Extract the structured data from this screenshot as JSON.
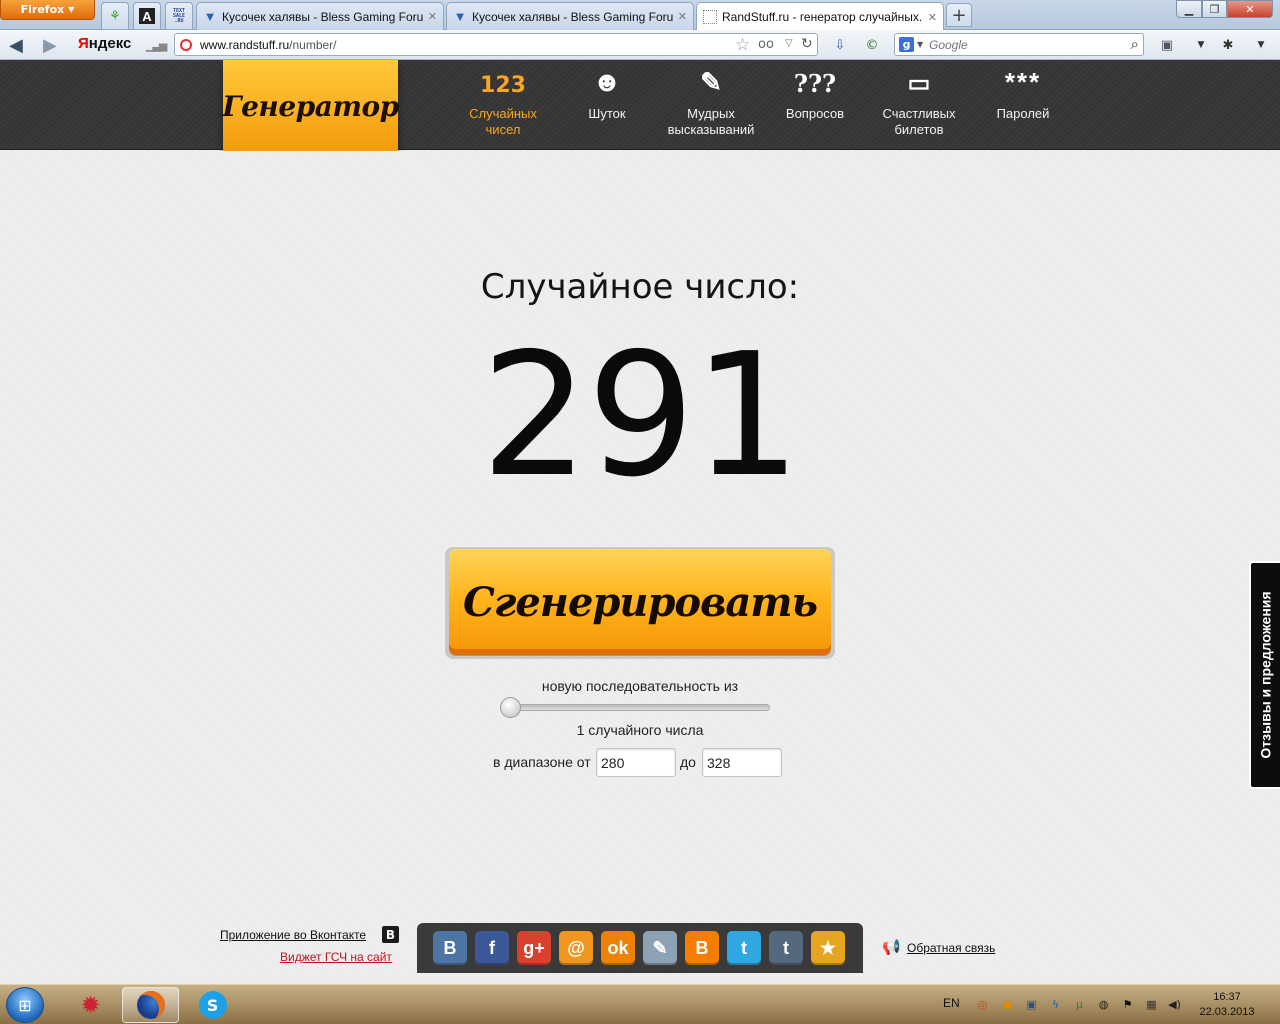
{
  "browser": {
    "menu_button_label": "Firefox",
    "app_tabs": [
      {
        "icon": "sprout-icon"
      },
      {
        "icon": "font-a-icon",
        "glyph": "A"
      },
      {
        "icon": "textsale-icon",
        "glyph": "TEXT SALE .RU"
      }
    ],
    "tabs": [
      {
        "title": "Кусочек халявы - Bless Gaming Foru...",
        "favicon": "bless-icon"
      },
      {
        "title": "Кусочек халявы - Bless Gaming Foru...",
        "favicon": "bless-icon"
      },
      {
        "title": "RandStuff.ru - генератор случайных...",
        "favicon": "blank-page-icon"
      }
    ],
    "new_tab_label": "+",
    "yandex_label": {
      "first": "Я",
      "rest": "ндекс"
    },
    "url": {
      "host": "www.randstuff.ru",
      "path": "/number/"
    },
    "search": {
      "engine_glyph": "g",
      "placeholder": "Google"
    }
  },
  "site": {
    "logo": "Генератор",
    "nav": [
      {
        "icon_text": "123",
        "label_line1": "Случайных",
        "label_line2": "чисел",
        "active": true
      },
      {
        "icon_text": "☻",
        "label_line1": "Шуток",
        "label_line2": "",
        "active": false
      },
      {
        "icon_text": "✎",
        "label_line1": "Мудрых",
        "label_line2": "высказываний",
        "active": false
      },
      {
        "icon_text": "???",
        "label_line1": "Вопросов",
        "label_line2": "",
        "active": false
      },
      {
        "icon_text": "▭",
        "label_line1": "Счастливых",
        "label_line2": "билетов",
        "active": false
      },
      {
        "icon_text": "***",
        "label_line1": "Паролей",
        "label_line2": "",
        "active": false
      }
    ],
    "result_label": "Случайное число:",
    "result_number": "291",
    "generate_button": "Сгенерировать",
    "sequence_text": "новую последовательность из",
    "slider_value_fraction": 0.0,
    "count_text": "1 случайного числа",
    "range_from_label": "в диапазоне от",
    "range_from_value": "280",
    "range_to_label": "до",
    "range_to_value": "328",
    "feedback_tab": "Отзывы и предложения",
    "vk_app_link": "Приложение во Вконтакте",
    "vk_icon_glyph": "В",
    "widget_link": "Виджет ГСЧ на сайт",
    "feedback_link": "Обратная связь",
    "share_buttons": [
      {
        "name": "vkontakte",
        "glyph": "В",
        "color": "#4c75a3"
      },
      {
        "name": "facebook",
        "glyph": "f",
        "color": "#3b5998"
      },
      {
        "name": "google-plus",
        "glyph": "g+",
        "color": "#d9412f"
      },
      {
        "name": "mail-ru",
        "glyph": "@",
        "color": "#f0961e"
      },
      {
        "name": "odnoklassniki",
        "glyph": "ok",
        "color": "#ee8208"
      },
      {
        "name": "livejournal",
        "glyph": "✎",
        "color": "#8ea2b6"
      },
      {
        "name": "blogger",
        "glyph": "B",
        "color": "#f57d00"
      },
      {
        "name": "twitter",
        "glyph": "t",
        "color": "#2fa7e0"
      },
      {
        "name": "tumblr",
        "glyph": "t",
        "color": "#56687e"
      },
      {
        "name": "favorite",
        "glyph": "★",
        "color": "#e5a521"
      }
    ],
    "accent_color": "#f7a623"
  },
  "taskbar": {
    "apps": [
      {
        "name": "game",
        "glyph": "✹",
        "color": "#5a2a1a"
      },
      {
        "name": "firefox",
        "glyph": "◉",
        "color": "#e0661b"
      },
      {
        "name": "skype",
        "glyph": "S",
        "color": "#1ea0e6"
      }
    ],
    "language": "EN",
    "time": "16:37",
    "date": "22.03.2013"
  }
}
